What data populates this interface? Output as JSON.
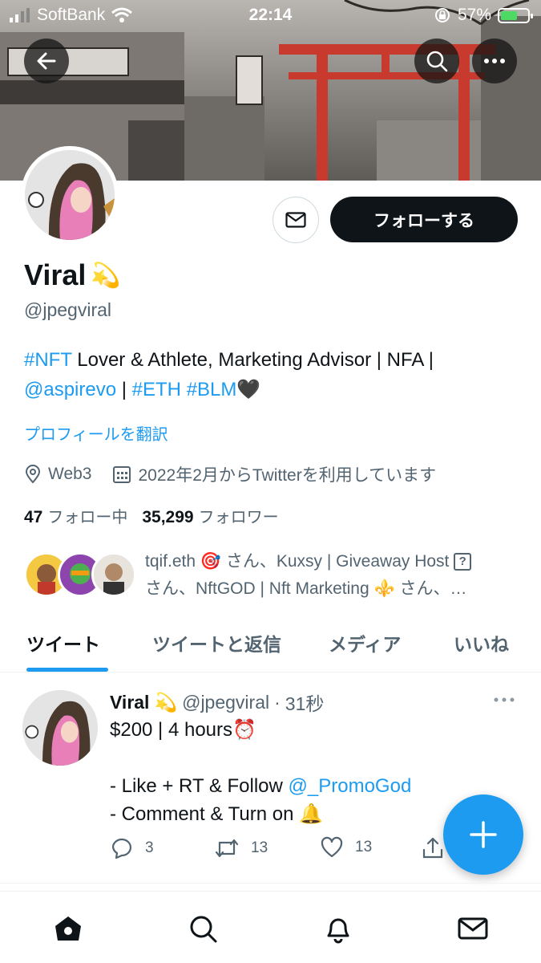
{
  "status_bar": {
    "carrier": "SoftBank",
    "time": "22:14",
    "battery": "57%"
  },
  "banner": {
    "background_colors": [
      "#b9b6b2",
      "#5f5b57"
    ],
    "torii_color": "#c83a2e"
  },
  "profile": {
    "name": "Viral",
    "name_emoji": "💫",
    "handle": "@jpegviral",
    "bio": {
      "part1": "#NFT",
      "part2": " Lover & Athlete, Marketing Advisor | NFA | ",
      "part3": "@aspirevo",
      "part4": " | ",
      "part5": "#ETH",
      "part6": " ",
      "part7": "#BLM",
      "part8": "🖤"
    },
    "translate_link": "プロフィールを翻訳",
    "location": "Web3",
    "joined": "2022年2月からTwitterを利用しています",
    "following_count": "47",
    "following_label": "フォロー中",
    "followers_count": "35,299",
    "followers_label": "フォロワー",
    "followed_by_line1": "tqif.eth 🎯 さん、Kuxsy | Giveaway Host",
    "followed_by_line2": "さん、NftGOD | Nft Marketing ⚜️ さん、…",
    "follow_button": "フォローする"
  },
  "tabs": [
    {
      "label": "ツイート",
      "active": true
    },
    {
      "label": "ツイートと返信",
      "active": false
    },
    {
      "label": "メディア",
      "active": false
    },
    {
      "label": "いいね",
      "active": false
    }
  ],
  "tweet": {
    "name": "Viral",
    "name_emoji": "💫",
    "handle": "@jpegviral",
    "separator": "·",
    "time": "31秒",
    "line1": "$200 | 4 hours⏰",
    "line2": "- Like + RT & Follow ",
    "mention": "@_PromoGod",
    "line3": "- Comment & Turn on 🔔",
    "replies": "3",
    "retweets": "13",
    "likes": "13"
  },
  "colors": {
    "accent": "#1d9bf0",
    "text": "#0f1419",
    "muted": "#536471"
  }
}
